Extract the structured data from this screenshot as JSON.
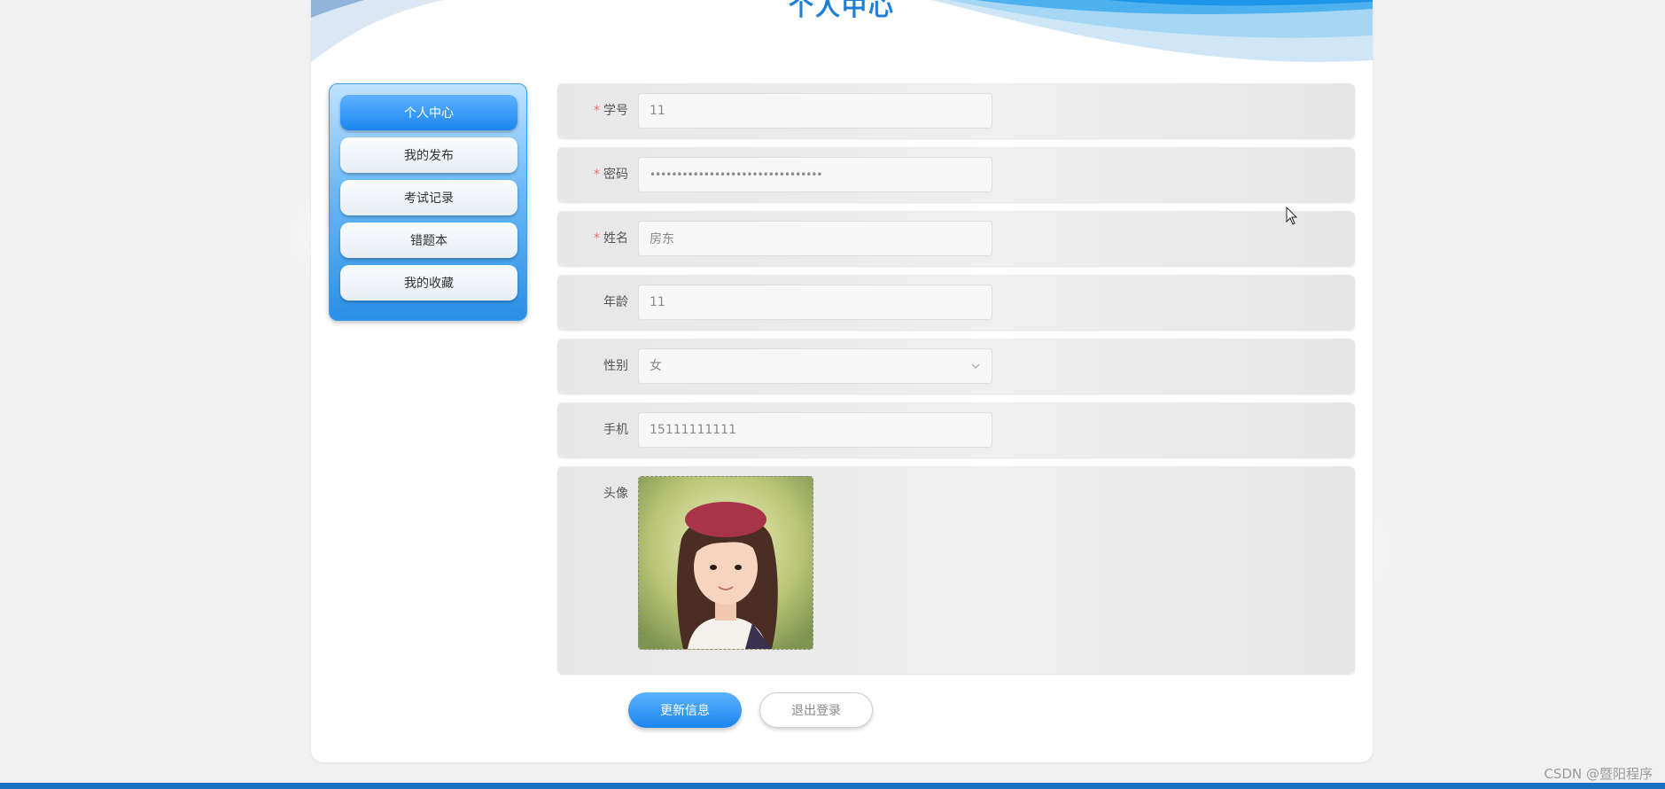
{
  "page": {
    "title": "个人中心"
  },
  "sidebar": {
    "items": [
      {
        "label": "个人中心",
        "active": true
      },
      {
        "label": "我的发布",
        "active": false
      },
      {
        "label": "考试记录",
        "active": false
      },
      {
        "label": "错题本",
        "active": false
      },
      {
        "label": "我的收藏",
        "active": false
      }
    ]
  },
  "form": {
    "student_id": {
      "label": "学号",
      "required": "*",
      "value": "11"
    },
    "password": {
      "label": "密码",
      "required": "*",
      "value": "••••••••••••••••••••••••••••••••"
    },
    "name": {
      "label": "姓名",
      "required": "*",
      "value": "房东"
    },
    "age": {
      "label": "年龄",
      "value": "11"
    },
    "gender": {
      "label": "性别",
      "value": "女"
    },
    "phone": {
      "label": "手机",
      "value": "15111111111"
    },
    "avatar": {
      "label": "头像"
    }
  },
  "actions": {
    "update_label": "更新信息",
    "logout_label": "退出登录"
  },
  "watermark": "CSDN @暨阳程序",
  "colors": {
    "accent": "#1e88f0",
    "title": "#1e7fd6",
    "required": "#f56c6c",
    "bottom_bar": "#1a6fc0"
  }
}
